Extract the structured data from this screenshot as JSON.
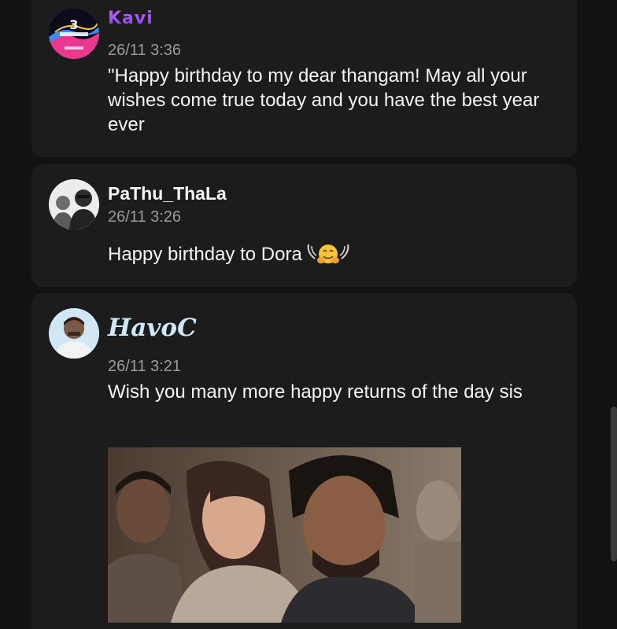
{
  "messages": [
    {
      "username": "Kavi",
      "timestamp": "26/11 3:36",
      "text": "\"Happy birthday to my dear thangam! May all your wishes come true today and you have the best year ever",
      "avatar_icon": "birthday-celebration-avatar"
    },
    {
      "username": "PaThu_ThaLa",
      "timestamp": "26/11 3:26",
      "text": "Happy birthday to Dora",
      "emoji": "hugging-face-emoji",
      "avatar_icon": "user-photo-avatar"
    },
    {
      "username": "HavoC",
      "timestamp": "26/11 3:21",
      "text": "Wish you many more happy returns of the day sis",
      "avatar_icon": "user-photo-avatar",
      "attachment": "gif-image"
    }
  ],
  "colors": {
    "background": "#121212",
    "card": "#1c1c1d",
    "timestamp": "#9b9b9b",
    "kavi_name": "#9a5cf0",
    "havoc_name": "#cfe8f8"
  }
}
